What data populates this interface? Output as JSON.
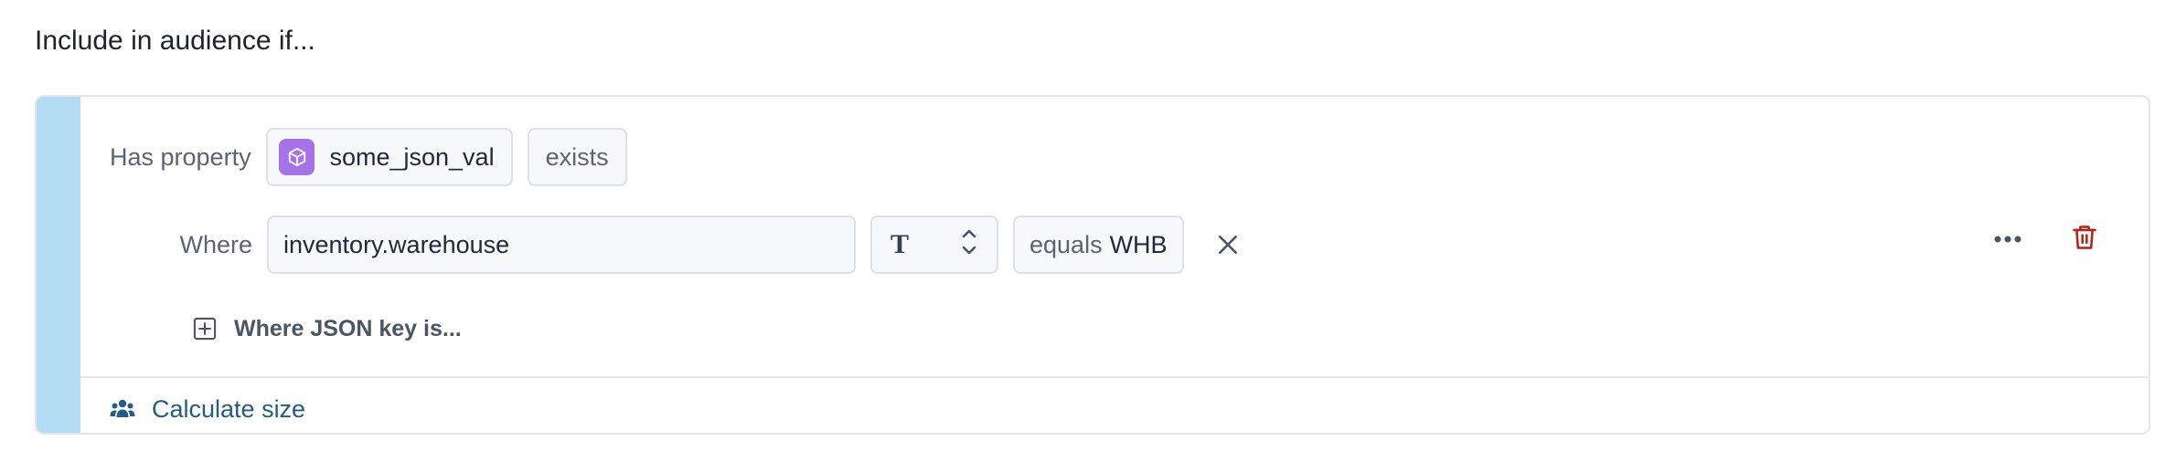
{
  "heading": "Include in audience if...",
  "condition": {
    "has_property_label": "Has property",
    "property_name": "some_json_val",
    "property_icon": "cube-icon",
    "operator": "exists"
  },
  "where": {
    "label": "Where",
    "json_path": "inventory.warehouse",
    "type_symbol": "T",
    "comparator": "equals",
    "value": "WHB"
  },
  "add_json_key_label": "Where JSON key is...",
  "calculate_size_label": "Calculate size",
  "colors": {
    "accent": "#b3dcf2",
    "property_icon_bg": "#a572e8",
    "delete": "#b42318",
    "link": "#245c85"
  }
}
